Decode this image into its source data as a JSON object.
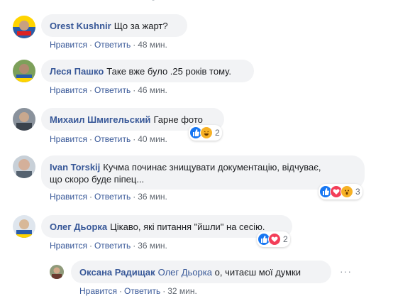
{
  "comments": [
    {
      "author": "Orest Kushnir",
      "text": "Що за жарт?",
      "like_label": "Нравится",
      "reply_label": "Ответить",
      "time": "48 мин.",
      "avatar_color": "#3a4a7a"
    },
    {
      "author": "Леся Пашко",
      "text": "Таке вже було .25 років тому.",
      "like_label": "Нравится",
      "reply_label": "Ответить",
      "time": "46 мин.",
      "avatar_color": "#6a8a4a"
    },
    {
      "author": "Михаил Шмигельский",
      "text": "Гарне фото",
      "like_label": "Нравится",
      "reply_label": "Ответить",
      "time": "40 мин.",
      "avatar_color": "#5a6470",
      "reactions": [
        "like-icon",
        "haha-icon"
      ],
      "reaction_count": "2"
    },
    {
      "author": "Ivan Torskij",
      "text_line1": "Кучма починає знищувати документацію, відчуває,",
      "text_line2": "що скоро буде піпец...",
      "like_label": "Нравится",
      "reply_label": "Ответить",
      "time": "36 мин.",
      "avatar_color": "#9aa6b2",
      "reactions": [
        "like-icon",
        "love-icon",
        "wow-icon"
      ],
      "reaction_count": "3"
    },
    {
      "author": "Олег Дьорка",
      "text": "Цікаво, які питання \"йшли\" на сесію.",
      "like_label": "Нравится",
      "reply_label": "Ответить",
      "time": "36 мин.",
      "avatar_color": "#3b5f8a",
      "reactions": [
        "like-icon",
        "love-icon"
      ],
      "reaction_count": "2"
    }
  ],
  "reply": {
    "author": "Оксана Радищак",
    "mention": "Олег Дьорка",
    "text": "о, читаєш мої думки",
    "like_label": "Нравится",
    "reply_label": "Ответить",
    "time": "32 мин.",
    "avatar_color": "#7a6a5a",
    "more_label": "···"
  }
}
